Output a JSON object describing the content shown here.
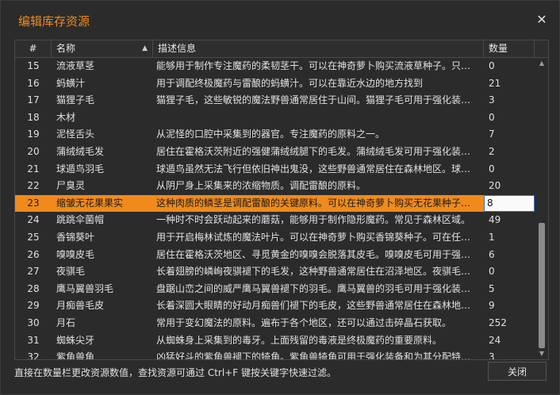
{
  "window": {
    "title": "编辑库存资源",
    "close_icon": "✕"
  },
  "table": {
    "columns": {
      "num": "#",
      "name": "名称",
      "desc": "描述信息",
      "qty": "数量"
    },
    "sort_indicator": "▲",
    "rows": [
      {
        "num": "15",
        "name": "流液草茎",
        "desc": "能够用于制作专注魔药的柔韧茎干。可以在神奇萝卜购买流液草种子。只能...",
        "qty": "0"
      },
      {
        "num": "16",
        "name": "蚂蟥汁",
        "desc": "用于调配终极魔药与雷酿的蚂蟥汁。可以在靠近水边的地方找到",
        "qty": "21"
      },
      {
        "num": "17",
        "name": "猫狸子毛",
        "desc": "猫狸子毛，这些敏锐的魔法野兽通常居住于山间。猫狸子毛可用于强化装备...",
        "qty": "3"
      },
      {
        "num": "18",
        "name": "木材",
        "desc": "",
        "qty": "0"
      },
      {
        "num": "19",
        "name": "泥怪舌头",
        "desc": "从泥怪的口腔中采集到的器官。专注魔药的原料之一。",
        "qty": "7"
      },
      {
        "num": "20",
        "name": "蒲绒绒毛发",
        "desc": "居住在霍格沃茨附近的强健蒲绒绒腿下的毛发。蒲绒绒毛发可用于强化装备...",
        "qty": "2"
      },
      {
        "num": "21",
        "name": "球遁鸟羽毛",
        "desc": "球遁鸟虽然无法飞行但依旧神出鬼没，这些野兽通常居住在森林地区。球遁...",
        "qty": "0"
      },
      {
        "num": "22",
        "name": "尸臭灵",
        "desc": "从阴尸身上采集来的浓缩物质。调配雷酿的原料。",
        "qty": "20"
      },
      {
        "num": "23",
        "name": "缩皱无花果果实",
        "desc": "这种肉质的鳞茎是调配雷酿的关键原料。可以在神奇萝卜购买无花果种子。...",
        "qty": "8"
      },
      {
        "num": "24",
        "name": "跳跳伞菌帽",
        "desc": "一种时不时会跃动起来的蘑菇，能够用于制作隐形魔药。常见于森林区域。",
        "qty": "49"
      },
      {
        "num": "25",
        "name": "香锦葵叶",
        "desc": "用于开启梅林试炼的魔法叶片。可以在神奇萝卜购买香锦葵种子。可在任何...",
        "qty": "1"
      },
      {
        "num": "26",
        "name": "嗅嗅皮毛",
        "desc": "居住在霍格沃茨地区、寻觅黄金的嗅嗅会脱落其皮毛。嗅嗅皮毛可用于强化...",
        "qty": "6"
      },
      {
        "num": "27",
        "name": "夜骐毛",
        "desc": "长着翅膀的嶙峋夜骐褪下的毛发，这种野兽通常居住在沼泽地区。夜骐毛发...",
        "qty": "0"
      },
      {
        "num": "28",
        "name": "鹰马翼兽羽毛",
        "desc": "盘踞山峦之间的威严鹰马翼兽褪下的羽毛。鹰马翼兽的羽毛可用于强化装备...",
        "qty": "5"
      },
      {
        "num": "29",
        "name": "月痴兽毛皮",
        "desc": "长着深圆大眼睛的好动月痴兽们褪下的毛皮，这些野兽通常居住在森林地区...",
        "qty": "9"
      },
      {
        "num": "30",
        "name": "月石",
        "desc": "常用于变幻魔法的原料。遍布于各个地区，还可以通过击碎晶石获取。",
        "qty": "252"
      },
      {
        "num": "31",
        "name": "蜘蛛尖牙",
        "desc": "从蜘蛛身上采集到的毒牙。上面残留的毒液是终极魔药的重要原料。",
        "qty": "24"
      },
      {
        "num": "32",
        "name": "紫角兽角",
        "desc": "凶猛好斗的紫角兽褪下的犄角。紫角兽犄角可用于强化装备和为其分配特质。",
        "qty": "3"
      }
    ],
    "selected_num": "23"
  },
  "scrollbar": {
    "up_icon": "▲",
    "down_icon": "▼"
  },
  "footer": {
    "hint": "直接在数量栏更改资源数值，查找资源可通过 Ctrl+F 键按关键字快速过滤。",
    "close_button": "关闭"
  },
  "colors": {
    "accent": "#f08a1c",
    "background": "#2b2b2b"
  }
}
